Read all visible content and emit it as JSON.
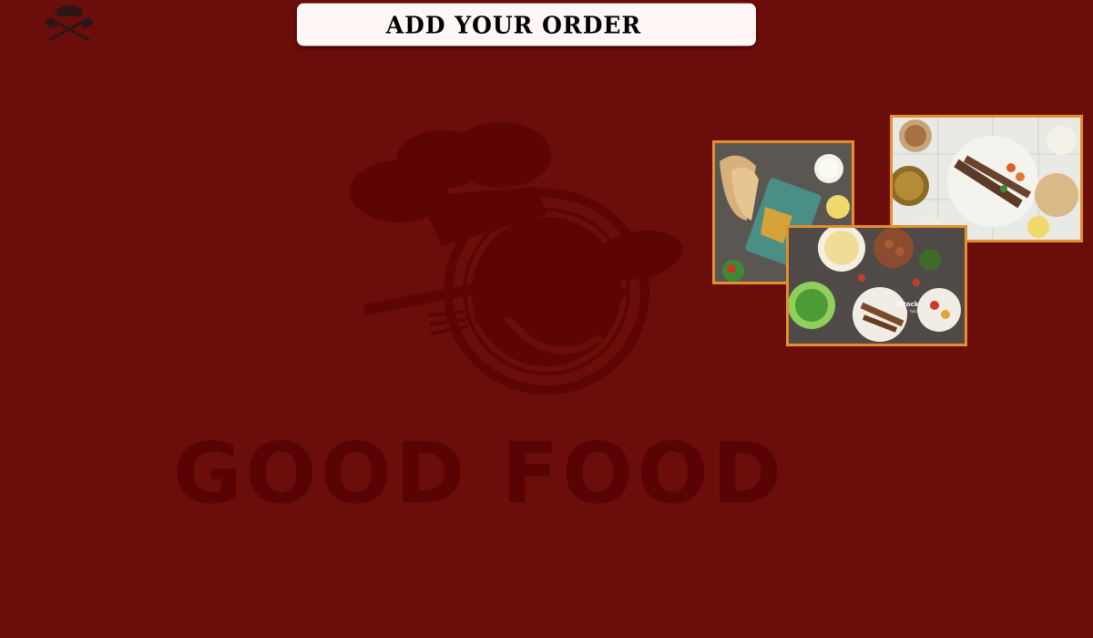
{
  "header": {
    "title": "ADD YOUR ORDER",
    "logo_icon": "chef-hat-crossed-utensils-icon"
  },
  "background": {
    "brand_text": "GOOD FOOD",
    "brand_logo_icon": "chef-hat-plate-spoon-fork-icon"
  },
  "gallery": {
    "photos": [
      {
        "subject": "flatbread, grilled chicken and sauces"
      },
      {
        "subject": "kebab platter with flatbreads"
      },
      {
        "subject": "hummus, salads, kebabs and falafel spread",
        "watermark": "iStock",
        "watermark_sub": "Credit: Yulia Gusterina"
      }
    ]
  },
  "colors": {
    "background": "#6b0d0b",
    "title_bar": "#fff7f5",
    "photo_border": "#e48f2b"
  }
}
